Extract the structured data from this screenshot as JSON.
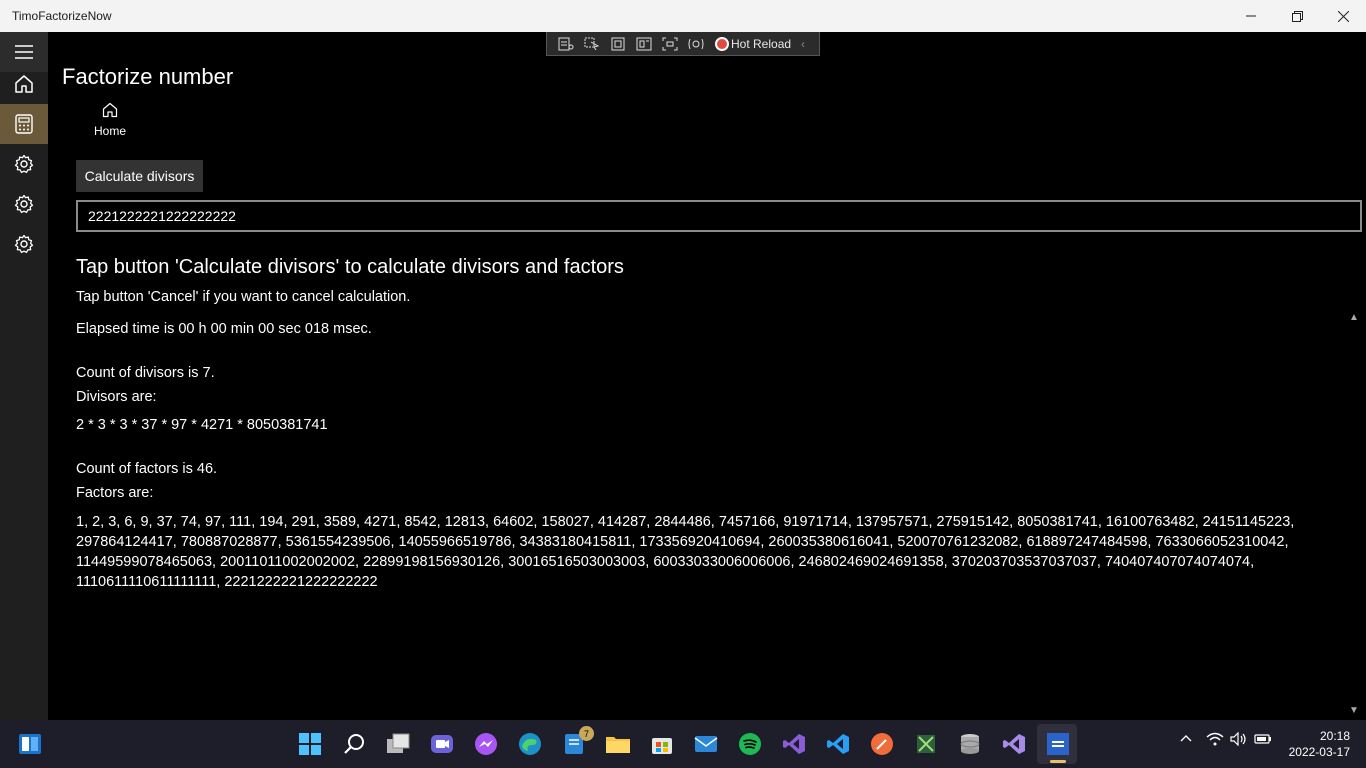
{
  "window": {
    "title": "TimoFactorizeNow"
  },
  "hot_reload": {
    "label": "Hot Reload"
  },
  "nav": {
    "items": [
      {
        "icon": "hamburger-icon"
      },
      {
        "icon": "home-icon"
      },
      {
        "icon": "calculator-icon",
        "active": true
      },
      {
        "icon": "gear-icon"
      },
      {
        "icon": "gear-icon"
      },
      {
        "icon": "gear-icon"
      }
    ]
  },
  "page": {
    "title": "Factorize number",
    "home_label": "Home"
  },
  "controls": {
    "calculate_button": "Calculate divisors",
    "number_value": "2221222221222222222"
  },
  "output": {
    "headline": "Tap button 'Calculate divisors' to calculate divisors and factors",
    "cancel_hint": "Tap button 'Cancel' if you want to cancel calculation.",
    "elapsed": "Elapsed time is 00 h 00 min 00 sec 018 msec.",
    "divisor_count": "Count of divisors is 7.",
    "divisors_label": "Divisors are:",
    "divisors": "2 * 3 * 3 * 37 * 97 * 4271 * 8050381741",
    "factor_count": "Count of factors is 46.",
    "factors_label": "Factors are:",
    "factors": "1, 2, 3, 6, 9, 37, 74, 97, 111, 194, 291, 3589, 4271, 8542, 12813, 64602, 158027, 414287, 2844486, 7457166, 91971714, 137957571, 275915142, 8050381741, 16100763482, 24151145223, 297864124417, 780887028877, 5361554239506, 14055966519786, 34383180415811, 173356920410694, 260035380616041, 520070761232082, 618897247484598, 7633066052310042, 11449599078465063, 20011011002002002, 22899198156930126, 30016516503003003, 60033033006006006, 246802469024691358, 370203703537037037, 740407407074074074, 1110611110611111111, 2221222221222222222"
  },
  "taskbar": {
    "badge_count": "7",
    "time": "20:18",
    "date": "2022-03-17"
  },
  "colors": {
    "accent_nav": "#6b5a3a",
    "taskbar": "#1e1e2a",
    "titlebar": "#f3f3f3"
  }
}
